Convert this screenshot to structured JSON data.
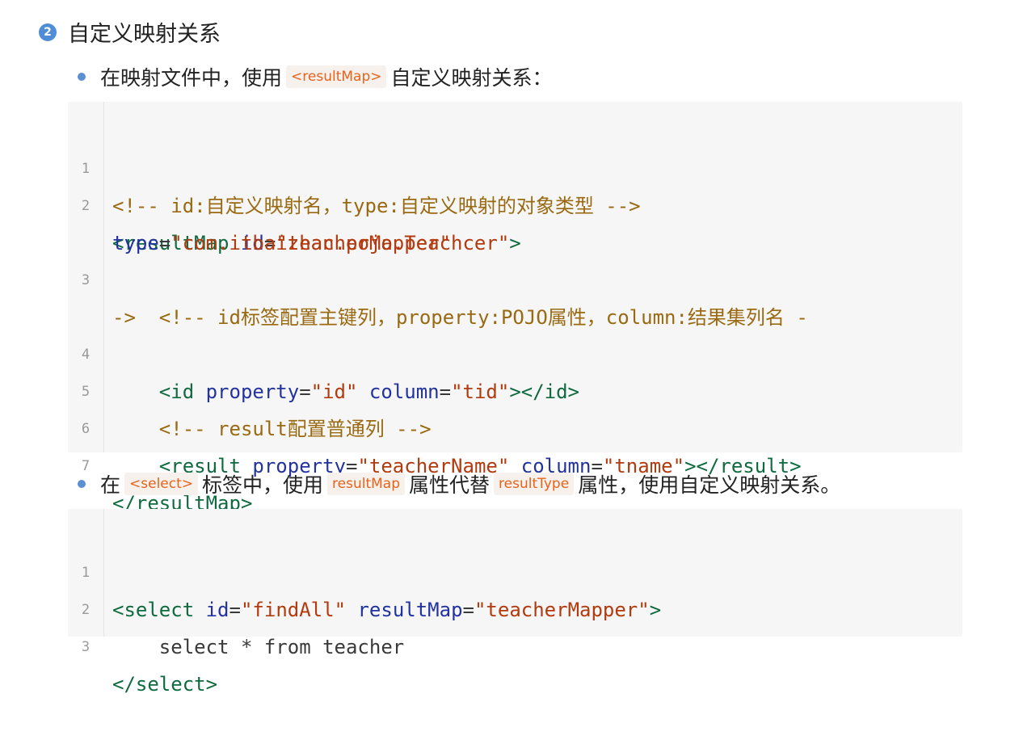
{
  "section": {
    "badge": "2",
    "title": "自定义映射关系"
  },
  "bullets": [
    {
      "before": "在映射文件中，使用",
      "tag1": "<resultMap>",
      "after": "自定义映射关系："
    },
    {
      "before": "在",
      "tag1": "<select>",
      "middle1": "标签中，使用",
      "tag2": "resultMap",
      "middle2": "属性代替",
      "tag3": "resultType",
      "after": "属性，使用自定义映射关系。"
    }
  ],
  "code_block_1": {
    "line_numbers": [
      "1",
      "2",
      "3",
      "4",
      "5",
      "6",
      "7"
    ],
    "lines": [
      "<!-- id:自定义映射名，type:自定义映射的对象类型 -->",
      "<resultMap id=\"teacherMapper\"",
      "type=\"com.itbaizhan.pojo.Teachcer\">",
      "    <!-- id标签配置主键列，property:POJO属性，column:结果集列名 -",
      "->",
      "    <id property=\"id\" column=\"tid\"></id>",
      "    <!-- result配置普通列 -->",
      "    <result property=\"teacherName\" column=\"tname\"></result>",
      "</resultMap>"
    ]
  },
  "code_block_2": {
    "line_numbers": [
      "1",
      "2",
      "3"
    ],
    "lines": [
      "<select id=\"findAll\" resultMap=\"teacherMapper\">",
      "    select * from teacher",
      "</select>"
    ]
  },
  "colors": {
    "tag": "#0f6a3f",
    "attribute": "#2233a0",
    "string": "#b23a0e",
    "comment": "#9a6a12",
    "inline_tag_text": "#e8621a",
    "badge": "#4f8dd6"
  }
}
